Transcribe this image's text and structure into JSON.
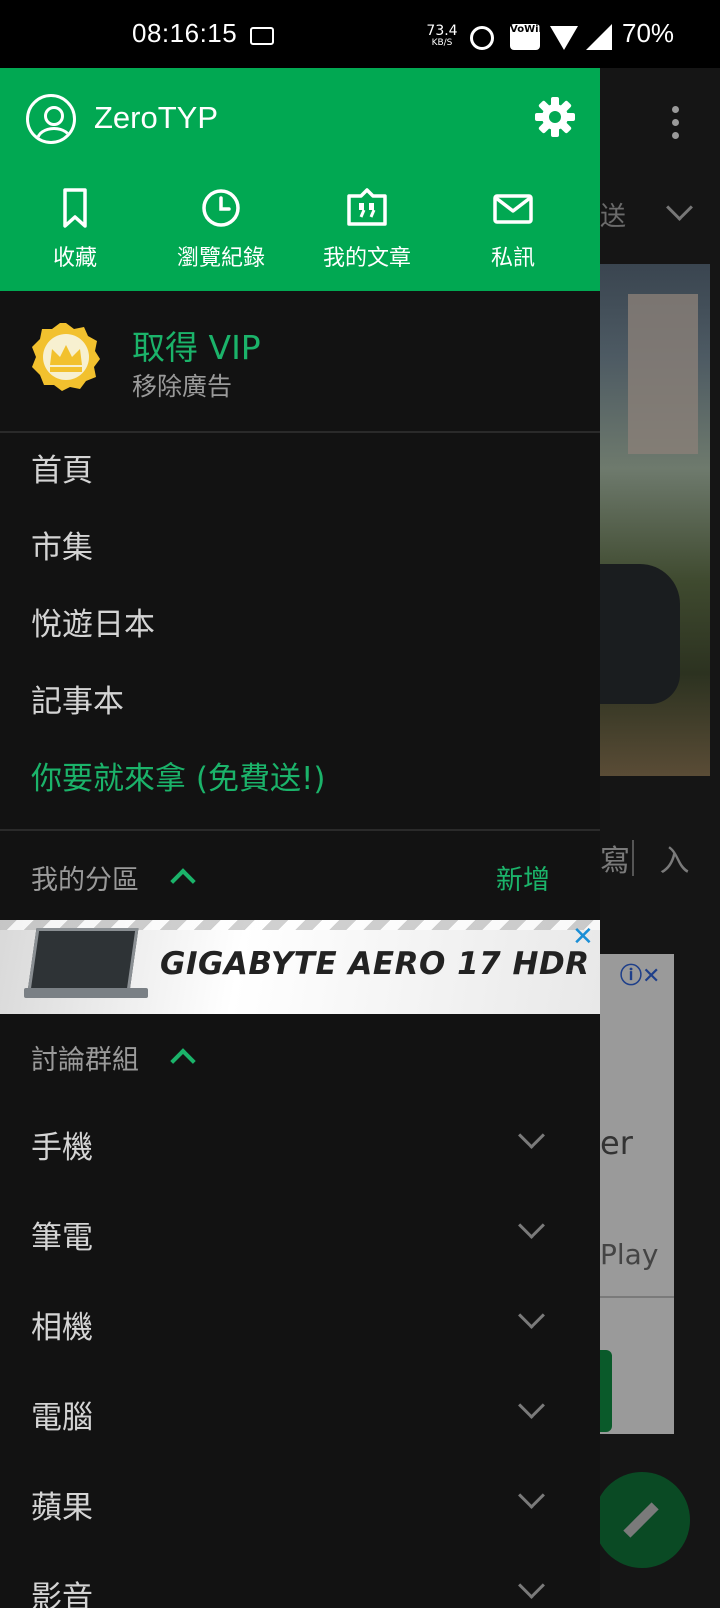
{
  "status_bar": {
    "time": "08:16:15",
    "net_speed": "73.4",
    "net_speed_unit": "KB/S",
    "vowifi": "VoWiFi",
    "battery": "70%"
  },
  "background_app": {
    "partial_text_1": "送",
    "partial_text_2": "寫",
    "partial_text_3": "入",
    "partial_text_4": "er",
    "partial_text_5": "Play"
  },
  "drawer": {
    "header": {
      "username": "ZeroTYP",
      "quick_actions": [
        {
          "label": "收藏",
          "icon": "bookmark-icon"
        },
        {
          "label": "瀏覽紀錄",
          "icon": "history-clock-icon"
        },
        {
          "label": "我的文章",
          "icon": "article-quote-icon"
        },
        {
          "label": "私訊",
          "icon": "mail-icon"
        }
      ],
      "accent_color": "#01a852"
    },
    "vip": {
      "title": "取得 VIP",
      "subtitle": "移除廣告"
    },
    "nav_items": [
      {
        "label": "首頁"
      },
      {
        "label": "市集"
      },
      {
        "label": "悅遊日本"
      },
      {
        "label": "記事本"
      },
      {
        "label": "你要就來拿 (免費送!)"
      }
    ],
    "my_sections": {
      "label": "我的分區",
      "add_label": "新增"
    },
    "ad": {
      "text": "GIGABYTE AERO 17 HDR"
    },
    "discussion_groups": {
      "label": "討論群組",
      "groups": [
        {
          "label": "手機"
        },
        {
          "label": "筆電"
        },
        {
          "label": "相機"
        },
        {
          "label": "電腦"
        },
        {
          "label": "蘋果"
        },
        {
          "label": "影音"
        }
      ]
    }
  }
}
